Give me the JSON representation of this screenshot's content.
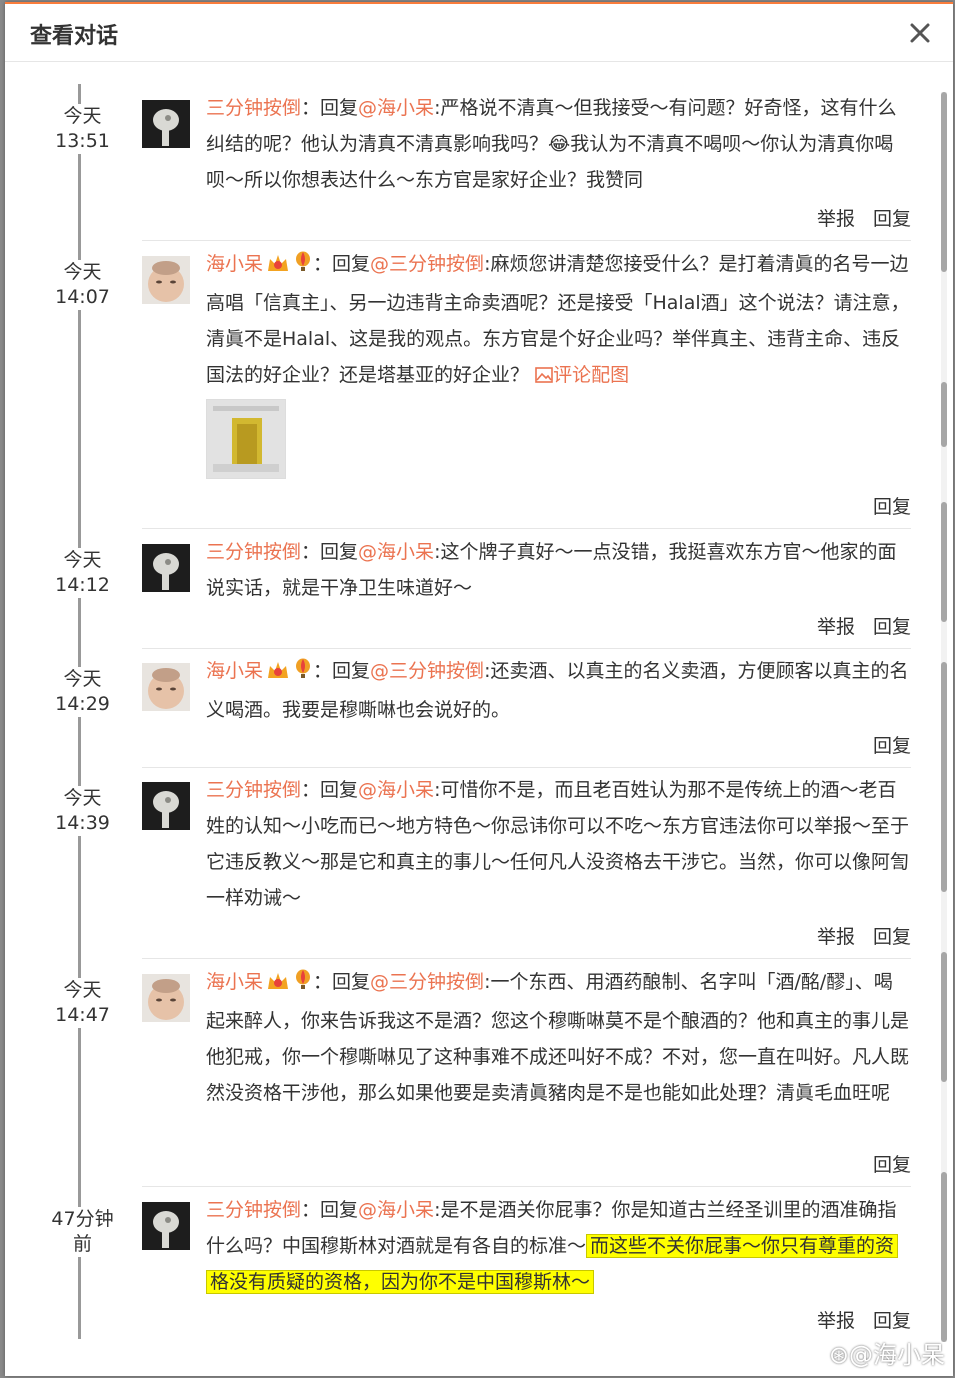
{
  "dialog": {
    "title": "查看对话"
  },
  "labels": {
    "report": "举报",
    "reply": "回复",
    "reply_to": "回复",
    "colon": "：",
    "sep": ":"
  },
  "comments": [
    {
      "time_day": "今天",
      "time_clock": "13:51",
      "user": "三分钟按倒",
      "at": "@海小呆",
      "text_a": "严格说不清真～但我接受～有问题？好奇怪，这有什么纠结的呢？他认为清真不清真影响我吗？",
      "emoji": "😂",
      "text_b": "我认为不清真不喝呗～你认为清真你喝呗～所以你想表达什么～东方官是家好企业？我赞同"
    },
    {
      "time_day": "今天",
      "time_clock": "14:07",
      "user": "海小呆",
      "at": "@三分钟按倒",
      "text_a": "麻烦您讲清楚您接受什么？是打着清眞的名号一边高唱「信真主」、另一边违背主命卖酒呢？还是接受「Halal酒」这个说法？请注意，清眞不是Halal、这是我的观点。东方官是个好企业吗？举伴真主、违背主命、违反国法的好企业？还是塔基亚的好企业？",
      "pic_link": "评论配图"
    },
    {
      "time_day": "今天",
      "time_clock": "14:12",
      "user": "三分钟按倒",
      "at": "@海小呆",
      "text_a": "这个牌子真好～一点没错，我挺喜欢东方官～他家的面说实话，就是干净卫生味道好～"
    },
    {
      "time_day": "今天",
      "time_clock": "14:29",
      "user": "海小呆",
      "at": "@三分钟按倒",
      "text_a": "还卖酒、以真主的名义卖酒，方便顾客以真主的名义喝酒。我要是穆嘶啉也会说好的。"
    },
    {
      "time_day": "今天",
      "time_clock": "14:39",
      "user": "三分钟按倒",
      "at": "@海小呆",
      "text_a": "可惜你不是，而且老百姓认为那不是传统上的酒～老百姓的认知～小吃而已～地方特色～你忌讳你可以不吃～东方官违法你可以举报～至于它违反教义～那是它和真主的事儿～任何凡人没资格去干涉它。当然，你可以像阿訇一样劝诫～"
    },
    {
      "time_day": "今天",
      "time_clock": "14:47",
      "user": "海小呆",
      "at": "@三分钟按倒",
      "text_a": "一个东西、用酒药酿制、名字叫「酒/酩/醪」、喝起来醉人，你来告诉我这不是酒？您这个穆嘶啉莫不是个酿酒的？他和真主的事儿是他犯戒，你一个穆嘶啉见了这种事难不成还叫好不成？不对，您一直在叫好。凡人既然没资格干涉他，那么如果他要是卖清眞豬肉是不是也能如此处理？清眞毛血旺呢"
    },
    {
      "time_relative": "47分钟前",
      "user": "三分钟按倒",
      "at": "@海小呆",
      "text_a": "是不是酒关你屁事？你是知道古兰经圣训里的酒准确指什么吗？中国穆斯林对酒就是有各自的标准～",
      "text_hl_1": "而这些不关你屁事～你只有尊重的资",
      "text_hl_2": "格没有质疑的资格，因为你不是中国穆斯林～"
    }
  ],
  "watermark": "@海小呆",
  "colors": {
    "accent": "#eb7350",
    "highlight": "#ffff00",
    "border_top": "#fa7d3c"
  }
}
